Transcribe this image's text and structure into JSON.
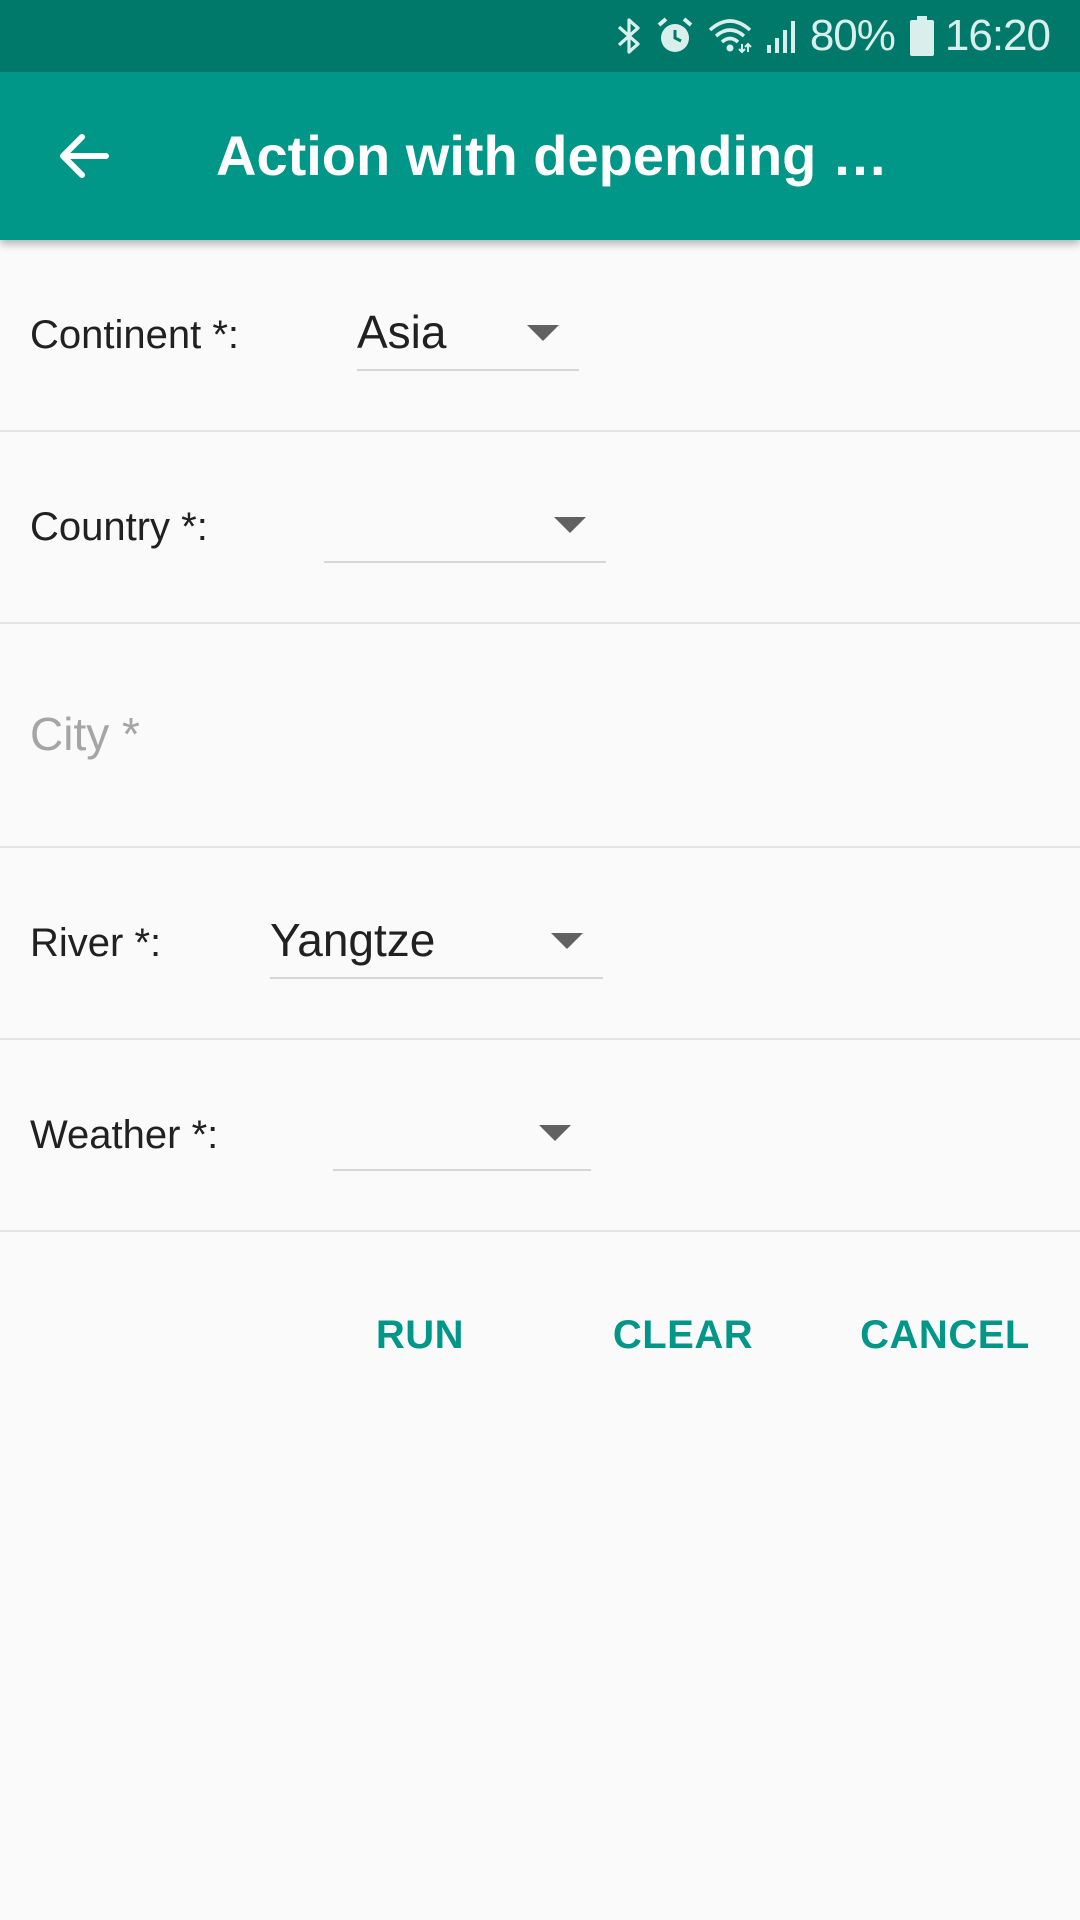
{
  "status_bar": {
    "icons": [
      "bluetooth-icon",
      "alarm-icon",
      "wifi-icon",
      "signal-icon",
      "battery-icon"
    ],
    "battery": "80%",
    "time": "16:20"
  },
  "toolbar": {
    "back_icon": "arrow-left-icon",
    "title": "Action with depending …",
    "background_color": "#009688"
  },
  "form": {
    "continent": {
      "label": "Continent *:",
      "value": "Asia"
    },
    "country": {
      "label": "Country *:",
      "value": ""
    },
    "city": {
      "placeholder": "City *",
      "value": ""
    },
    "river": {
      "label": "River *:",
      "value": "Yangtze"
    },
    "weather": {
      "label": "Weather *:",
      "value": ""
    }
  },
  "actions": {
    "run": "RUN",
    "clear": "CLEAR",
    "cancel": "CANCEL",
    "color": "#009688"
  }
}
